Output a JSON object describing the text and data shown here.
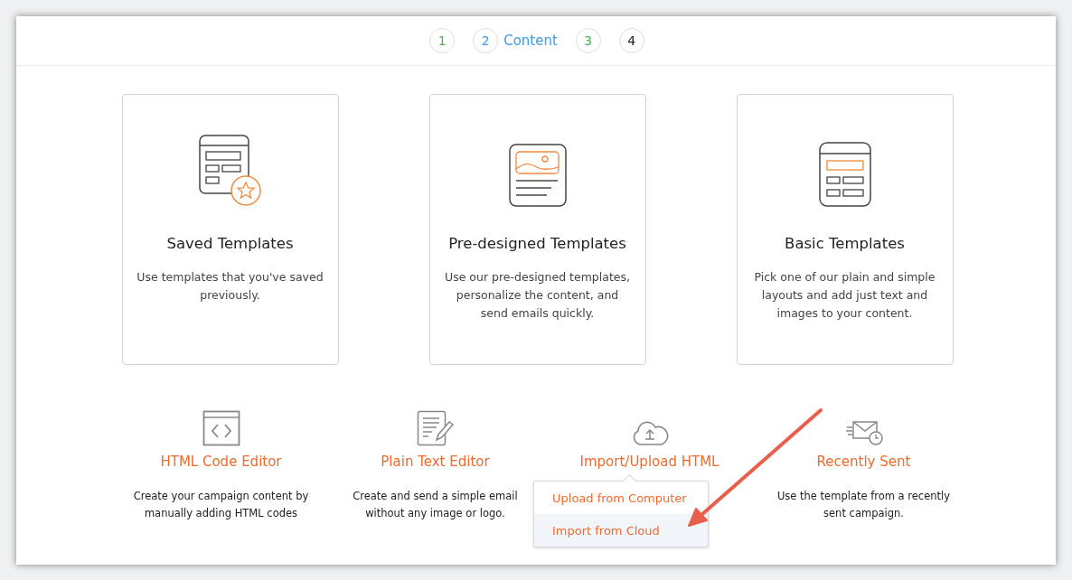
{
  "steps": [
    {
      "number": "1",
      "completed": true,
      "selected": false
    },
    {
      "number": "2",
      "completed": false,
      "selected": true,
      "label": "Content"
    },
    {
      "number": "3",
      "completed": true,
      "selected": false
    },
    {
      "number": "4",
      "completed": false,
      "selected": false
    }
  ],
  "template_cards": [
    {
      "kind": "saved",
      "title": "Saved Templates",
      "description": "Use templates that you've saved previously."
    },
    {
      "kind": "predesigned",
      "title": "Pre-designed Templates",
      "description": "Use our pre-designed templates, personalize the content, and send emails quickly."
    },
    {
      "kind": "basic",
      "title": "Basic Templates",
      "description": "Pick one of our plain and simple layouts and add just text and images to your content."
    }
  ],
  "options": [
    {
      "kind": "code",
      "title": "HTML Code Editor",
      "description": "Create your campaign content by manually adding HTML codes"
    },
    {
      "kind": "text",
      "title": "Plain Text Editor",
      "description": "Create and send a simple email without any image or logo."
    },
    {
      "kind": "upload",
      "title": "Import/Upload HTML",
      "menu": [
        {
          "label": "Upload from Computer",
          "selected": false
        },
        {
          "label": "Import from Cloud",
          "selected": true
        }
      ]
    },
    {
      "kind": "recent",
      "title": "Recently Sent",
      "description": "Use the template from a recently sent campaign."
    }
  ]
}
